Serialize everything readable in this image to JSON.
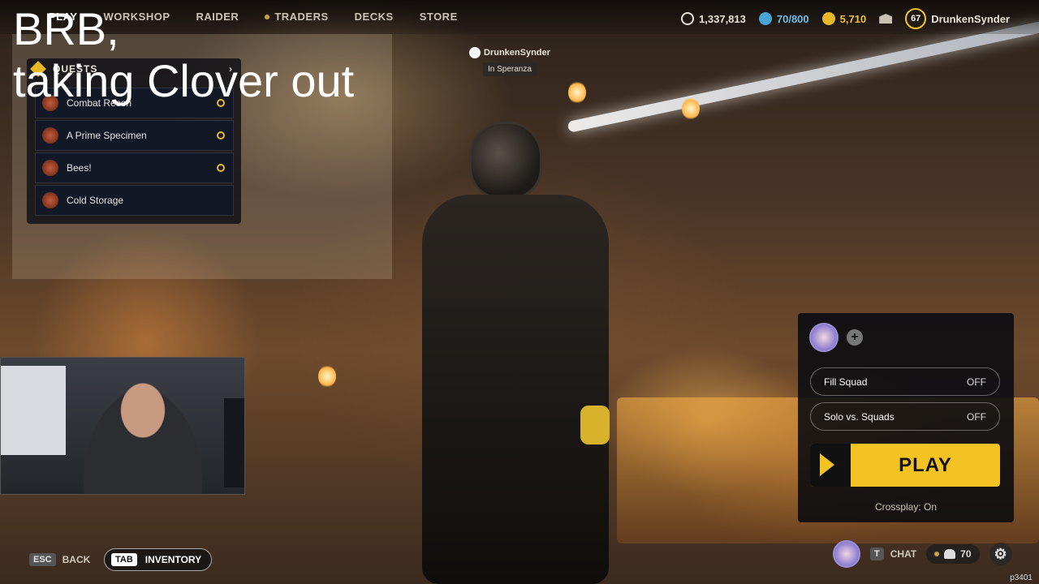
{
  "nav": {
    "tabs": [
      {
        "label": "PLAY"
      },
      {
        "label": "WORKSHOP"
      },
      {
        "label": "RAIDER"
      },
      {
        "label": "TRADERS"
      },
      {
        "label": "DECKS"
      },
      {
        "label": "STORE"
      }
    ],
    "stats": {
      "coins": "1,337,813",
      "blue_currency": "70/800",
      "gold_currency": "5,710"
    },
    "player": {
      "level": "67",
      "name": "DrunkenSynder"
    }
  },
  "overlay": {
    "line1": "BRB,",
    "line2": "taking Clover out"
  },
  "quests": {
    "title": "QUESTS",
    "items": [
      {
        "label": "Combat Recon"
      },
      {
        "label": "A Prime Specimen"
      },
      {
        "label": "Bees!"
      },
      {
        "label": "Cold Storage"
      }
    ]
  },
  "player_tag": {
    "name": "DrunkenSynder",
    "location": "In Speranza"
  },
  "play_panel": {
    "fill_squad": {
      "label": "Fill Squad",
      "value": "OFF"
    },
    "solo_vs_squads": {
      "label": "Solo vs. Squads",
      "value": "OFF"
    },
    "play_label": "PLAY",
    "crossplay": "Crossplay: On"
  },
  "bottom": {
    "back": {
      "key": "ESC",
      "label": "BACK"
    },
    "inventory": {
      "key": "TAB",
      "label": "INVENTORY"
    },
    "chat": {
      "key": "T",
      "label": "CHAT"
    },
    "friends_count": "70",
    "build": "p3401"
  },
  "colors": {
    "accent": "#f5c224",
    "panel": "#080a10"
  }
}
